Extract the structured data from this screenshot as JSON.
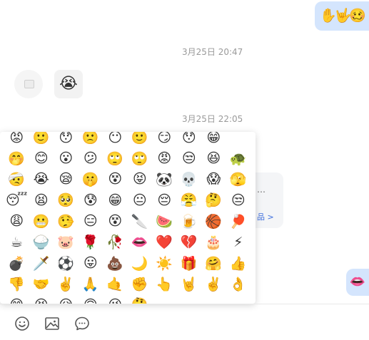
{
  "chat": {
    "top_right_emojis": "✋🤟🥴",
    "timestamp_1": "3月25日 20:47",
    "left_emoji_message": "😭",
    "timestamp_2": "3月25日 22:05",
    "card_partial_text": "…",
    "card_partial_link": "品 >",
    "right_emoji_message": "👄"
  },
  "emoji_panel": {
    "rows": [
      [
        "😡",
        "🙂",
        "😯",
        "🙁",
        "😶",
        "🙂",
        "😏",
        "😯",
        "😁"
      ],
      [
        "🤭",
        "😊",
        "😮",
        "😕",
        "🙄",
        "🙄",
        "😡",
        "😒",
        "😆",
        "🐢"
      ],
      [
        "🤕",
        "😭",
        "😪",
        "🤫",
        "😵",
        "😝",
        "🐼",
        "💀",
        "😱",
        "🫣"
      ],
      [
        "😴",
        "😫",
        "🥺",
        "😰",
        "😁",
        "😐",
        "😔",
        "😤",
        "🤔",
        "😒"
      ],
      [
        "😩",
        "😬",
        "🤥",
        "😑",
        "😵",
        "🔪",
        "🍉",
        "🍺",
        "🏀",
        "🏓"
      ],
      [
        "☕",
        "🍚",
        "🐷",
        "🌹",
        "🥀",
        "👄",
        "❤️",
        "💔",
        "🎂",
        "⚡"
      ],
      [
        "💣",
        "🗡️",
        "⚽",
        "😛",
        "💩",
        "🌙",
        "☀️",
        "🎁",
        "🤗",
        "👍"
      ],
      [
        "👎",
        "🤝",
        "✌️",
        "🙏",
        "🤙",
        "✊",
        "👆",
        "🤘",
        "✌️",
        "👌"
      ],
      [
        "😊",
        "😆",
        "😥",
        "🙃",
        "😜",
        "🤔"
      ]
    ]
  },
  "toolbar": {
    "icons": [
      "emoji-icon",
      "image-icon",
      "more-chat-icon"
    ]
  }
}
